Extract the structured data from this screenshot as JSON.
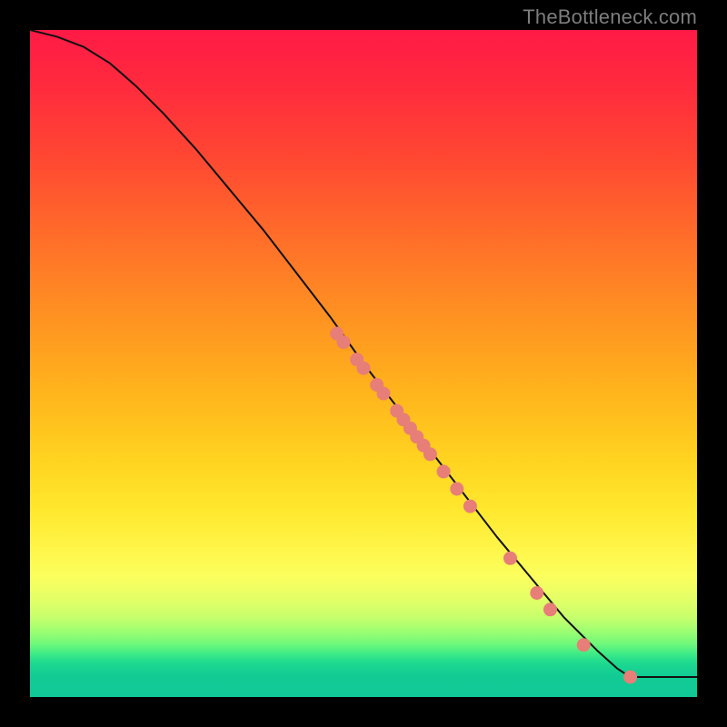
{
  "watermark": "TheBottleneck.com",
  "colors": {
    "curve_stroke": "#111111",
    "marker_fill": "#e77e77",
    "marker_stroke": "#c95b55",
    "plot_border": "#000000"
  },
  "chart_data": {
    "type": "line",
    "title": "",
    "xlabel": "",
    "ylabel": "",
    "xlim": [
      0,
      100
    ],
    "ylim": [
      0,
      100
    ],
    "curve": [
      {
        "x": 0,
        "y": 100
      },
      {
        "x": 4,
        "y": 99
      },
      {
        "x": 8,
        "y": 97.5
      },
      {
        "x": 12,
        "y": 95
      },
      {
        "x": 16,
        "y": 91.5
      },
      {
        "x": 20,
        "y": 87.5
      },
      {
        "x": 25,
        "y": 82
      },
      {
        "x": 30,
        "y": 76
      },
      {
        "x": 35,
        "y": 70
      },
      {
        "x": 40,
        "y": 63.5
      },
      {
        "x": 45,
        "y": 57
      },
      {
        "x": 50,
        "y": 50
      },
      {
        "x": 55,
        "y": 43.5
      },
      {
        "x": 60,
        "y": 37
      },
      {
        "x": 65,
        "y": 30.5
      },
      {
        "x": 70,
        "y": 24
      },
      {
        "x": 75,
        "y": 18
      },
      {
        "x": 80,
        "y": 12
      },
      {
        "x": 85,
        "y": 7
      },
      {
        "x": 88,
        "y": 4.3
      },
      {
        "x": 90,
        "y": 3
      },
      {
        "x": 92,
        "y": 3
      },
      {
        "x": 96,
        "y": 3
      },
      {
        "x": 100,
        "y": 3
      }
    ],
    "markers": [
      {
        "x": 46,
        "y": 54.5
      },
      {
        "x": 47,
        "y": 53.2
      },
      {
        "x": 49,
        "y": 50.6
      },
      {
        "x": 50,
        "y": 49.3
      },
      {
        "x": 52,
        "y": 46.8
      },
      {
        "x": 53,
        "y": 45.5
      },
      {
        "x": 55,
        "y": 42.9
      },
      {
        "x": 56,
        "y": 41.6
      },
      {
        "x": 57,
        "y": 40.3
      },
      {
        "x": 58,
        "y": 39
      },
      {
        "x": 59,
        "y": 37.7
      },
      {
        "x": 60,
        "y": 36.4
      },
      {
        "x": 62,
        "y": 33.8
      },
      {
        "x": 64,
        "y": 31.2
      },
      {
        "x": 66,
        "y": 28.6
      },
      {
        "x": 72,
        "y": 20.8
      },
      {
        "x": 76,
        "y": 15.6
      },
      {
        "x": 78,
        "y": 13.1
      },
      {
        "x": 83,
        "y": 7.8
      },
      {
        "x": 90,
        "y": 3
      }
    ]
  }
}
